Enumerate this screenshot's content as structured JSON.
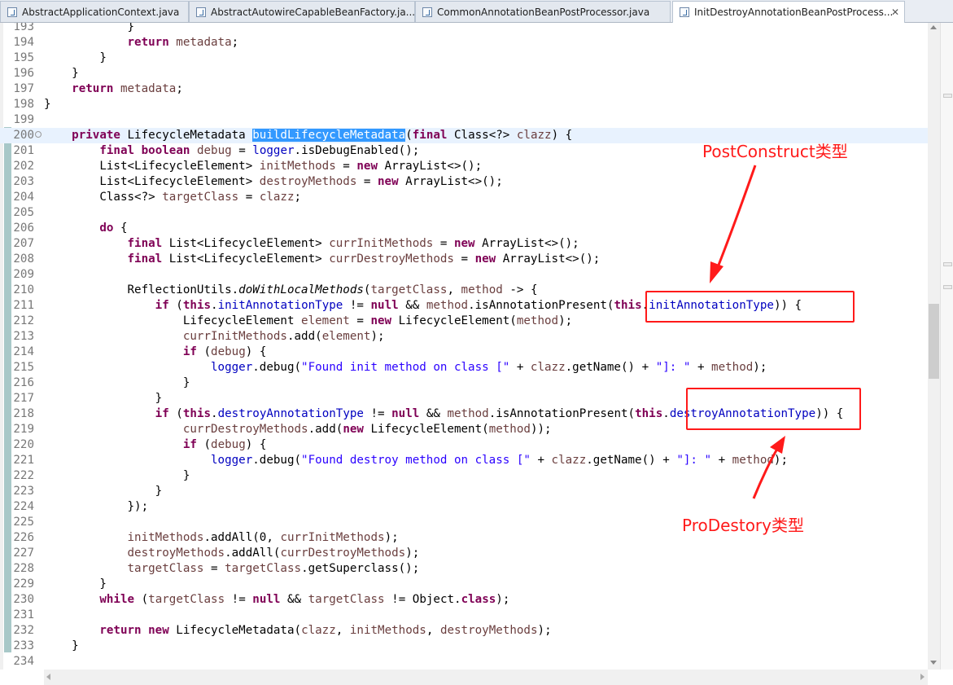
{
  "tabs": [
    {
      "label": "AbstractApplicationContext.java",
      "active": false
    },
    {
      "label": "AbstractAutowireCapableBeanFactory.ja...",
      "active": false
    },
    {
      "label": "CommonAnnotationBeanPostProcessor.java",
      "active": false
    },
    {
      "label": "InitDestroyAnnotationBeanPostProcess...",
      "active": true
    }
  ],
  "tab_close_glyph": "✕",
  "fold_glyph": "⊖",
  "lines": [
    {
      "no": "193",
      "tokens": [
        {
          "t": "            }"
        }
      ]
    },
    {
      "no": "194",
      "tokens": [
        {
          "t": "            "
        },
        {
          "t": "return",
          "c": "kw"
        },
        {
          "t": " "
        },
        {
          "t": "metadata",
          "c": "var"
        },
        {
          "t": ";"
        }
      ]
    },
    {
      "no": "195",
      "tokens": [
        {
          "t": "        }"
        }
      ]
    },
    {
      "no": "196",
      "tokens": [
        {
          "t": "    }"
        }
      ]
    },
    {
      "no": "197",
      "tokens": [
        {
          "t": "    "
        },
        {
          "t": "return",
          "c": "kw"
        },
        {
          "t": " "
        },
        {
          "t": "metadata",
          "c": "var"
        },
        {
          "t": ";"
        }
      ]
    },
    {
      "no": "198",
      "tokens": [
        {
          "t": "}"
        }
      ]
    },
    {
      "no": "199",
      "tokens": []
    },
    {
      "no": "200",
      "fold": true,
      "current": true,
      "tokens": [
        {
          "t": "    "
        },
        {
          "t": "private",
          "c": "kw"
        },
        {
          "t": " LifecycleMetadata "
        },
        {
          "t": "buildLifecycleMetadata",
          "c": "hl"
        },
        {
          "t": "("
        },
        {
          "t": "final",
          "c": "kw"
        },
        {
          "t": " Class<?> "
        },
        {
          "t": "clazz",
          "c": "var"
        },
        {
          "t": ") {"
        }
      ]
    },
    {
      "no": "201",
      "tokens": [
        {
          "t": "        "
        },
        {
          "t": "final",
          "c": "kw"
        },
        {
          "t": " "
        },
        {
          "t": "boolean",
          "c": "kw"
        },
        {
          "t": " "
        },
        {
          "t": "debug",
          "c": "var"
        },
        {
          "t": " = "
        },
        {
          "t": "logger",
          "c": "fld"
        },
        {
          "t": ".isDebugEnabled();"
        }
      ]
    },
    {
      "no": "202",
      "tokens": [
        {
          "t": "        List<LifecycleElement> "
        },
        {
          "t": "initMethods",
          "c": "var"
        },
        {
          "t": " = "
        },
        {
          "t": "new",
          "c": "kw"
        },
        {
          "t": " ArrayList<>();"
        }
      ]
    },
    {
      "no": "203",
      "tokens": [
        {
          "t": "        List<LifecycleElement> "
        },
        {
          "t": "destroyMethods",
          "c": "var"
        },
        {
          "t": " = "
        },
        {
          "t": "new",
          "c": "kw"
        },
        {
          "t": " ArrayList<>();"
        }
      ]
    },
    {
      "no": "204",
      "tokens": [
        {
          "t": "        Class<?> "
        },
        {
          "t": "targetClass",
          "c": "var"
        },
        {
          "t": " = "
        },
        {
          "t": "clazz",
          "c": "var"
        },
        {
          "t": ";"
        }
      ]
    },
    {
      "no": "205",
      "tokens": []
    },
    {
      "no": "206",
      "tokens": [
        {
          "t": "        "
        },
        {
          "t": "do",
          "c": "kw"
        },
        {
          "t": " {"
        }
      ]
    },
    {
      "no": "207",
      "tokens": [
        {
          "t": "            "
        },
        {
          "t": "final",
          "c": "kw"
        },
        {
          "t": " List<LifecycleElement> "
        },
        {
          "t": "currInitMethods",
          "c": "var"
        },
        {
          "t": " = "
        },
        {
          "t": "new",
          "c": "kw"
        },
        {
          "t": " ArrayList<>();"
        }
      ]
    },
    {
      "no": "208",
      "tokens": [
        {
          "t": "            "
        },
        {
          "t": "final",
          "c": "kw"
        },
        {
          "t": " List<LifecycleElement> "
        },
        {
          "t": "currDestroyMethods",
          "c": "var"
        },
        {
          "t": " = "
        },
        {
          "t": "new",
          "c": "kw"
        },
        {
          "t": " ArrayList<>();"
        }
      ]
    },
    {
      "no": "209",
      "tokens": []
    },
    {
      "no": "210",
      "tokens": [
        {
          "t": "            ReflectionUtils."
        },
        {
          "t": "doWithLocalMethods",
          "c": "it"
        },
        {
          "t": "("
        },
        {
          "t": "targetClass",
          "c": "var"
        },
        {
          "t": ", "
        },
        {
          "t": "method",
          "c": "var"
        },
        {
          "t": " -> {"
        }
      ]
    },
    {
      "no": "211",
      "tokens": [
        {
          "t": "                "
        },
        {
          "t": "if",
          "c": "kw"
        },
        {
          "t": " ("
        },
        {
          "t": "this",
          "c": "kw"
        },
        {
          "t": "."
        },
        {
          "t": "initAnnotationType",
          "c": "fld"
        },
        {
          "t": " != "
        },
        {
          "t": "null",
          "c": "kw"
        },
        {
          "t": " && "
        },
        {
          "t": "method",
          "c": "var"
        },
        {
          "t": ".isAnnotationPresent("
        },
        {
          "t": "this",
          "c": "kw"
        },
        {
          "t": "."
        },
        {
          "t": "initAnnotationType",
          "c": "fld"
        },
        {
          "t": ")) {"
        }
      ]
    },
    {
      "no": "212",
      "tokens": [
        {
          "t": "                    LifecycleElement "
        },
        {
          "t": "element",
          "c": "var"
        },
        {
          "t": " = "
        },
        {
          "t": "new",
          "c": "kw"
        },
        {
          "t": " LifecycleElement("
        },
        {
          "t": "method",
          "c": "var"
        },
        {
          "t": ");"
        }
      ]
    },
    {
      "no": "213",
      "tokens": [
        {
          "t": "                    "
        },
        {
          "t": "currInitMethods",
          "c": "var"
        },
        {
          "t": ".add("
        },
        {
          "t": "element",
          "c": "var"
        },
        {
          "t": ");"
        }
      ]
    },
    {
      "no": "214",
      "tokens": [
        {
          "t": "                    "
        },
        {
          "t": "if",
          "c": "kw"
        },
        {
          "t": " ("
        },
        {
          "t": "debug",
          "c": "var"
        },
        {
          "t": ") {"
        }
      ]
    },
    {
      "no": "215",
      "tokens": [
        {
          "t": "                        "
        },
        {
          "t": "logger",
          "c": "fld"
        },
        {
          "t": ".debug("
        },
        {
          "t": "\"Found init method on class [\"",
          "c": "str"
        },
        {
          "t": " + "
        },
        {
          "t": "clazz",
          "c": "var"
        },
        {
          "t": ".getName() + "
        },
        {
          "t": "\"]: \"",
          "c": "str"
        },
        {
          "t": " + "
        },
        {
          "t": "method",
          "c": "var"
        },
        {
          "t": ");"
        }
      ]
    },
    {
      "no": "216",
      "tokens": [
        {
          "t": "                    }"
        }
      ]
    },
    {
      "no": "217",
      "tokens": [
        {
          "t": "                }"
        }
      ]
    },
    {
      "no": "218",
      "tokens": [
        {
          "t": "                "
        },
        {
          "t": "if",
          "c": "kw"
        },
        {
          "t": " ("
        },
        {
          "t": "this",
          "c": "kw"
        },
        {
          "t": "."
        },
        {
          "t": "destroyAnnotationType",
          "c": "fld"
        },
        {
          "t": " != "
        },
        {
          "t": "null",
          "c": "kw"
        },
        {
          "t": " && "
        },
        {
          "t": "method",
          "c": "var"
        },
        {
          "t": ".isAnnotationPresent("
        },
        {
          "t": "this",
          "c": "kw"
        },
        {
          "t": "."
        },
        {
          "t": "destroyAnnotationType",
          "c": "fld"
        },
        {
          "t": ")) {"
        }
      ]
    },
    {
      "no": "219",
      "tokens": [
        {
          "t": "                    "
        },
        {
          "t": "currDestroyMethods",
          "c": "var"
        },
        {
          "t": ".add("
        },
        {
          "t": "new",
          "c": "kw"
        },
        {
          "t": " LifecycleElement("
        },
        {
          "t": "method",
          "c": "var"
        },
        {
          "t": "));"
        }
      ]
    },
    {
      "no": "220",
      "tokens": [
        {
          "t": "                    "
        },
        {
          "t": "if",
          "c": "kw"
        },
        {
          "t": " ("
        },
        {
          "t": "debug",
          "c": "var"
        },
        {
          "t": ") {"
        }
      ]
    },
    {
      "no": "221",
      "tokens": [
        {
          "t": "                        "
        },
        {
          "t": "logger",
          "c": "fld"
        },
        {
          "t": ".debug("
        },
        {
          "t": "\"Found destroy method on class [\"",
          "c": "str"
        },
        {
          "t": " + "
        },
        {
          "t": "clazz",
          "c": "var"
        },
        {
          "t": ".getName() + "
        },
        {
          "t": "\"]: \"",
          "c": "str"
        },
        {
          "t": " + "
        },
        {
          "t": "method",
          "c": "var"
        },
        {
          "t": ");"
        }
      ]
    },
    {
      "no": "222",
      "tokens": [
        {
          "t": "                    }"
        }
      ]
    },
    {
      "no": "223",
      "tokens": [
        {
          "t": "                }"
        }
      ]
    },
    {
      "no": "224",
      "tokens": [
        {
          "t": "            });"
        }
      ]
    },
    {
      "no": "225",
      "tokens": []
    },
    {
      "no": "226",
      "tokens": [
        {
          "t": "            "
        },
        {
          "t": "initMethods",
          "c": "var"
        },
        {
          "t": ".addAll(0, "
        },
        {
          "t": "currInitMethods",
          "c": "var"
        },
        {
          "t": ");"
        }
      ]
    },
    {
      "no": "227",
      "tokens": [
        {
          "t": "            "
        },
        {
          "t": "destroyMethods",
          "c": "var"
        },
        {
          "t": ".addAll("
        },
        {
          "t": "currDestroyMethods",
          "c": "var"
        },
        {
          "t": ");"
        }
      ]
    },
    {
      "no": "228",
      "tokens": [
        {
          "t": "            "
        },
        {
          "t": "targetClass",
          "c": "var"
        },
        {
          "t": " = "
        },
        {
          "t": "targetClass",
          "c": "var"
        },
        {
          "t": ".getSuperclass();"
        }
      ]
    },
    {
      "no": "229",
      "tokens": [
        {
          "t": "        }"
        }
      ]
    },
    {
      "no": "230",
      "tokens": [
        {
          "t": "        "
        },
        {
          "t": "while",
          "c": "kw"
        },
        {
          "t": " ("
        },
        {
          "t": "targetClass",
          "c": "var"
        },
        {
          "t": " != "
        },
        {
          "t": "null",
          "c": "kw"
        },
        {
          "t": " && "
        },
        {
          "t": "targetClass",
          "c": "var"
        },
        {
          "t": " != Object."
        },
        {
          "t": "class",
          "c": "kw"
        },
        {
          "t": ");"
        }
      ]
    },
    {
      "no": "231",
      "tokens": []
    },
    {
      "no": "232",
      "tokens": [
        {
          "t": "        "
        },
        {
          "t": "return",
          "c": "kw"
        },
        {
          "t": " "
        },
        {
          "t": "new",
          "c": "kw"
        },
        {
          "t": " LifecycleMetadata("
        },
        {
          "t": "clazz",
          "c": "var"
        },
        {
          "t": ", "
        },
        {
          "t": "initMethods",
          "c": "var"
        },
        {
          "t": ", "
        },
        {
          "t": "destroyMethods",
          "c": "var"
        },
        {
          "t": ");"
        }
      ]
    },
    {
      "no": "233",
      "tokens": [
        {
          "t": "    }"
        }
      ]
    },
    {
      "no": "234",
      "tokens": []
    }
  ],
  "annotations": {
    "post_construct_label": "PostConstruct类型",
    "pre_destroy_label": "ProDestory类型",
    "annotation_color": "#ff1a1a"
  },
  "colors": {
    "keyword": "#7f0055",
    "field": "#0000c0",
    "local_variable": "#6a3e3e",
    "string": "#2a00ff",
    "selection": "#3399ff",
    "current_line": "#e8f2fe"
  }
}
